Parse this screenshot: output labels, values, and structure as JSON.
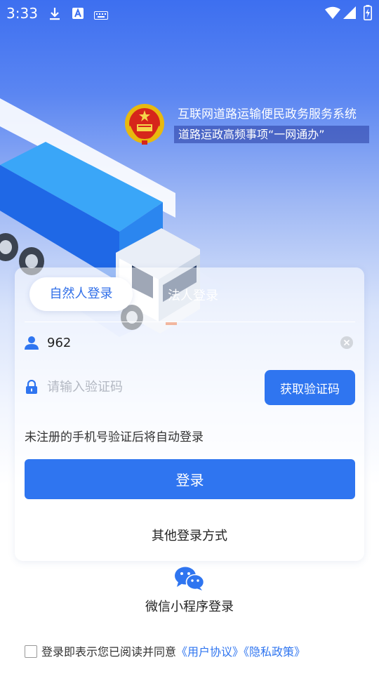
{
  "status_bar": {
    "time": "3:33",
    "left_icons": [
      "download-icon",
      "a-badge-icon",
      "keyboard-icon"
    ],
    "right_icons": [
      "wifi-icon",
      "signal-icon",
      "battery-charging-icon"
    ]
  },
  "header": {
    "system_name": "互联网道路运输便民政务服务系统",
    "slogan": "道路运政高频事项“一网通办”"
  },
  "login": {
    "tabs": [
      {
        "label": "自然人登录",
        "active": true
      },
      {
        "label": "法人登录",
        "active": false
      }
    ],
    "phone_value": "962",
    "code_placeholder": "请输入验证码",
    "get_code_label": "获取验证码",
    "hint": "未注册的手机号验证后将自动登录",
    "submit_label": "登录",
    "other_methods_label": "其他登录方式",
    "wechat_label": "微信小程序登录"
  },
  "agreement": {
    "text": "登录即表示您已阅读并同意",
    "user_agreement": "《用户协议》",
    "privacy_policy": "《隐私政策》"
  },
  "colors": {
    "primary": "#2f75f0",
    "header_blue": "#3d6ff0",
    "wechat_blue": "#2f75f0"
  }
}
